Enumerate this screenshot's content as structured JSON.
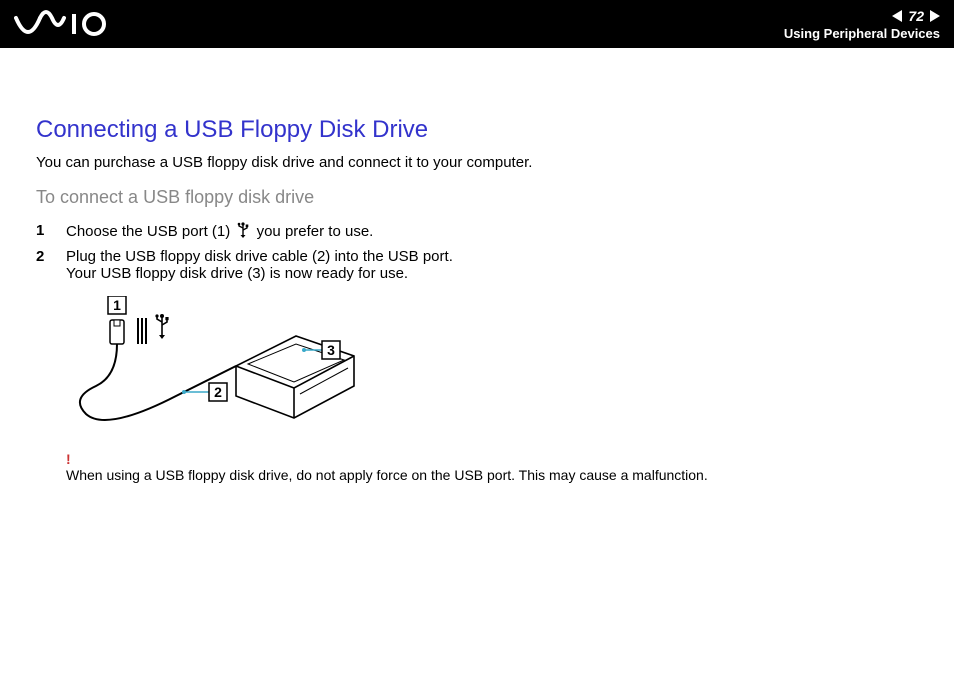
{
  "header": {
    "page_number": "72",
    "section": "Using Peripheral Devices"
  },
  "content": {
    "title": "Connecting a USB Floppy Disk Drive",
    "intro": "You can purchase a USB floppy disk drive and connect it to your computer.",
    "subtitle": "To connect a USB floppy disk drive",
    "steps": [
      {
        "num": "1",
        "text_before": "Choose the USB port (1) ",
        "text_after": " you prefer to use."
      },
      {
        "num": "2",
        "text_before": "Plug the USB floppy disk drive cable (2) into the USB port.",
        "text_line2": "Your USB floppy disk drive (3) is now ready for use."
      }
    ],
    "figure_labels": {
      "a": "1",
      "b": "2",
      "c": "3"
    },
    "warning": {
      "bang": "!",
      "text": "When using a USB floppy disk drive, do not apply force on the USB port. This may cause a malfunction."
    }
  }
}
